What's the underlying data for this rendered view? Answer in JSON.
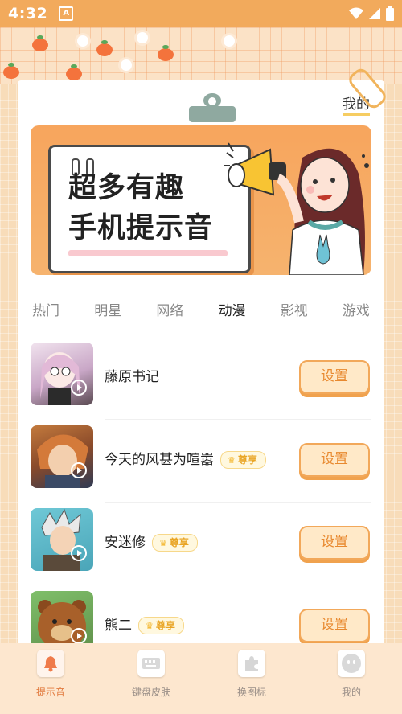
{
  "status_bar": {
    "time": "4:32",
    "notification_glyph": "A"
  },
  "header": {
    "mine_label": "我的"
  },
  "banner": {
    "line1": "超多有趣",
    "line2": "手机提示音"
  },
  "tabs": [
    {
      "label": "热门",
      "active": false
    },
    {
      "label": "明星",
      "active": false
    },
    {
      "label": "网络",
      "active": false
    },
    {
      "label": "动漫",
      "active": true
    },
    {
      "label": "影视",
      "active": false
    },
    {
      "label": "游戏",
      "active": false
    }
  ],
  "items": [
    {
      "title": "藤原书记",
      "vip": "",
      "button": "设置",
      "thumb_color": "#d8c2d8"
    },
    {
      "title": "今天的风甚为喧嚣",
      "vip": "尊享",
      "button": "设置",
      "thumb_color": "#7d3f28"
    },
    {
      "title": "安迷修",
      "vip": "尊享",
      "button": "设置",
      "thumb_color": "#5cb6c6"
    },
    {
      "title": "熊二",
      "vip": "尊享",
      "button": "设置",
      "thumb_color": "#a6632e"
    }
  ],
  "bottom_nav": [
    {
      "label": "提示音",
      "icon": "bell-icon",
      "active": true
    },
    {
      "label": "键盘皮肤",
      "icon": "keyboard-icon",
      "active": false
    },
    {
      "label": "换图标",
      "icon": "puzzle-icon",
      "active": false
    },
    {
      "label": "我的",
      "icon": "smiley-icon",
      "active": false
    }
  ],
  "colors": {
    "accent": "#f2aa5c",
    "button_text": "#e8892f",
    "vip_text": "#e9a525"
  }
}
